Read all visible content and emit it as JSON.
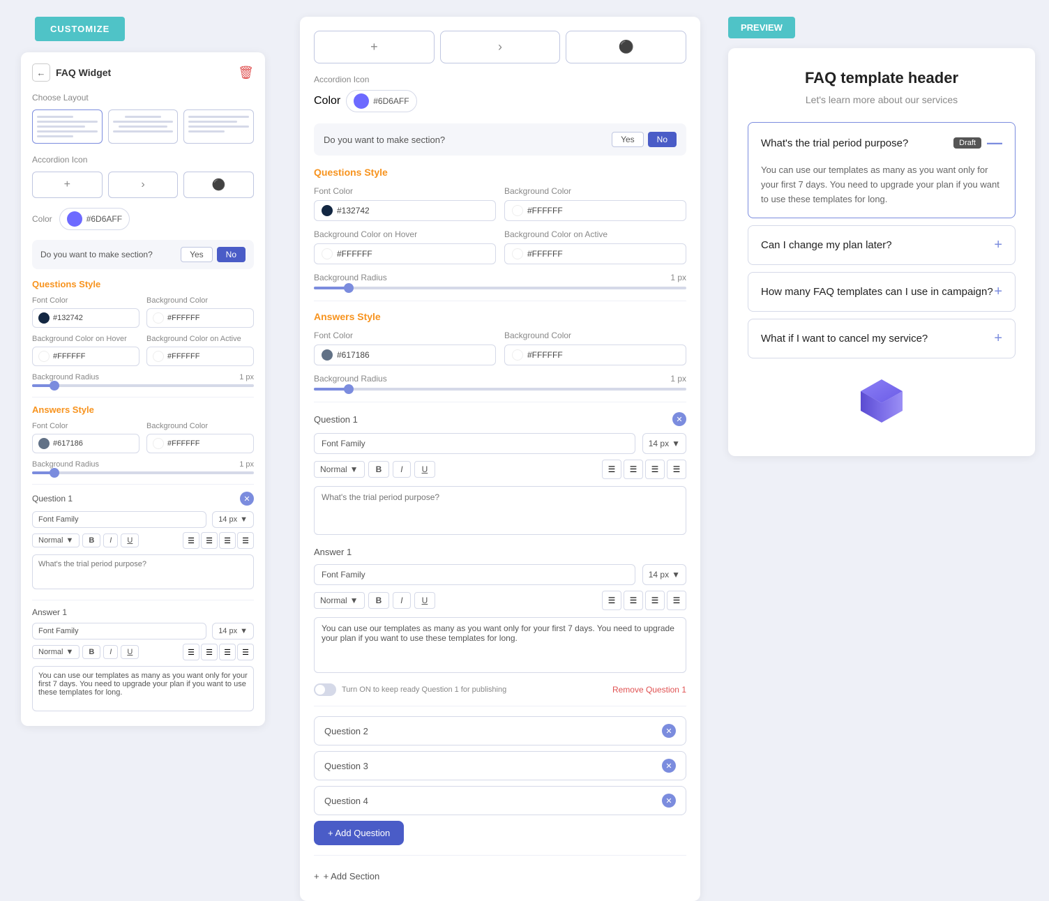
{
  "customize": {
    "label": "CUSTOMIZE"
  },
  "left_panel": {
    "title": "FAQ Widget",
    "choose_layout": "Choose Layout",
    "accordion_icon": "Accordion Icon",
    "color_label": "Color",
    "color_hex": "#6D6AFF",
    "section_toggle": {
      "label": "Do you want to make section?",
      "yes": "Yes",
      "no": "No"
    },
    "questions_style": "Questions Style",
    "answers_style": "Answers Style",
    "font_color": "Font Color",
    "background_color": "Background Color",
    "bg_color_hover": "Background Color on Hover",
    "bg_color_active": "Background Color on Active",
    "bg_radius": "Background Radius",
    "radius_value": "1 px",
    "q_font_hex": "#132742",
    "q_bg_hex": "#FFFFFF",
    "q_hover_hex": "#FFFFFF",
    "q_active_hex": "#FFFFFF",
    "a_font_hex": "#617186",
    "a_bg_hex": "#FFFFFF",
    "question1_label": "Question 1",
    "answer1_label": "Answer 1",
    "font_family": "Font Family",
    "font_size": "14 px",
    "normal_label": "Normal",
    "bold_label": "B",
    "italic_label": "I",
    "underline_label": "U",
    "q1_placeholder": "What's the trial period purpose?",
    "a1_placeholder": "You can use our templates as many as you want only for your first 7 days.",
    "remove_q1": "Remove Question 1",
    "question2": "Question 2",
    "question3": "Question 3",
    "question4": "Question 4",
    "add_question": "+ Add Question",
    "add_section": "+ Add Section"
  },
  "preview": {
    "badge": "PREVIEW",
    "header_title": "FAQ template header",
    "header_sub": "Let's learn more about our services",
    "questions": [
      {
        "title": "What's the trial period purpose?",
        "badge": "Draft",
        "expanded": true,
        "answer": "You can use our templates as many as you want only for your first 7 days. You need to upgrade your plan if you want to use these templates for long."
      },
      {
        "title": "Can I change my plan later?",
        "expanded": false
      },
      {
        "title": "How many FAQ templates can I use in campaign?",
        "expanded": false
      },
      {
        "title": "What if I want to cancel my service?",
        "expanded": false
      }
    ]
  },
  "colors": {
    "teal": "#4fc3c7",
    "purple": "#4a5cc7",
    "orange": "#f7931e",
    "red": "#e05252",
    "swatch_purple": "#6d6aff",
    "black_dot": "#132742",
    "gray_dot": "#617186"
  }
}
